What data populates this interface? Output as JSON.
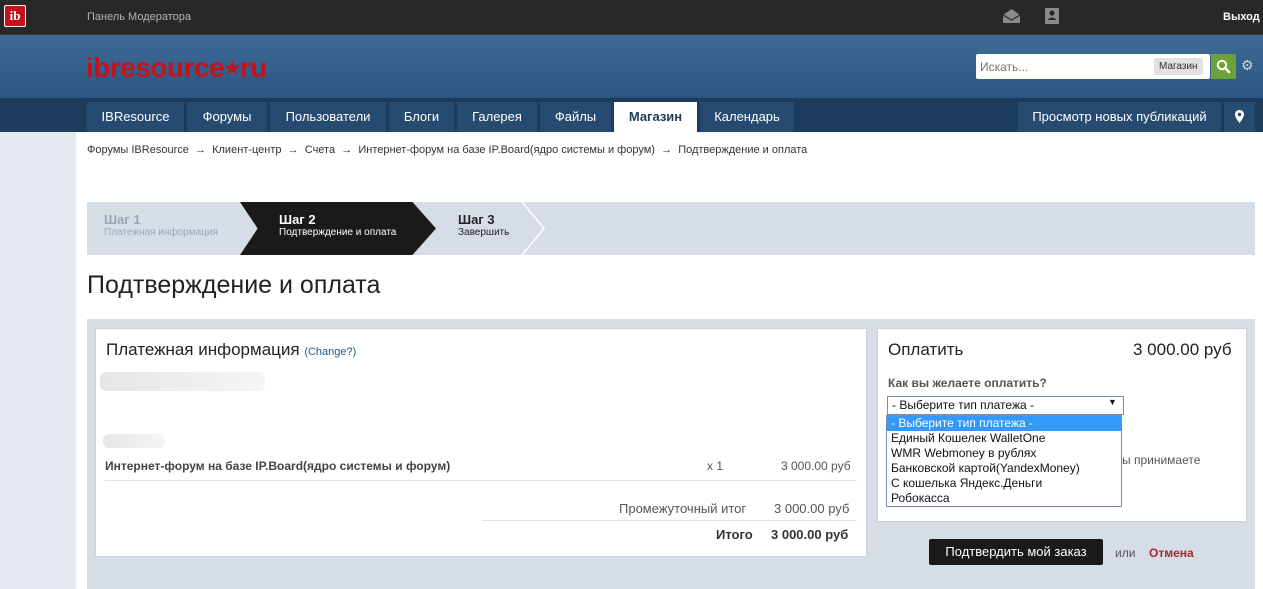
{
  "topbar": {
    "logo_text": "ib",
    "mod_panel": "Панель Модератора",
    "logout": "Выход"
  },
  "header": {
    "brand_ib": "ib",
    "brand_resource": "resource",
    "brand_star": "★",
    "brand_ru": "ru",
    "search_placeholder": "Искать...",
    "search_scope": "Магазин"
  },
  "nav": {
    "tabs": [
      "IBResource",
      "Форумы",
      "Пользователи",
      "Блоги",
      "Галерея",
      "Файлы",
      "Магазин",
      "Календарь"
    ],
    "active": "Магазин",
    "new_posts": "Просмотр новых публикаций"
  },
  "breadcrumb": {
    "items": [
      "Форумы IBResource",
      "Клиент-центр",
      "Счета",
      "Интернет-форум на базе IP.Board(ядро системы и форум)",
      "Подтверждение и оплата"
    ],
    "sep": "→"
  },
  "steps": [
    {
      "title": "Шаг 1",
      "sub": "Платежная информация"
    },
    {
      "title": "Шаг 2",
      "sub": "Подтверждение и оплата"
    },
    {
      "title": "Шаг 3",
      "sub": "Завершить"
    }
  ],
  "page_title": "Подтверждение и оплата",
  "billing": {
    "title": "Платежная информация",
    "change": "(Change?)",
    "item_name": "Интернет-форум на базе IP.Board(ядро системы и форум)",
    "item_qty": "x 1",
    "item_price": "3 000.00 руб",
    "subtotal_label": "Промежуточный итог",
    "subtotal": "3 000.00 руб",
    "total_label": "Итого",
    "total": "3 000.00 руб"
  },
  "payment": {
    "title": "Оплатить",
    "amount": "3 000.00 руб",
    "question": "Как вы желаете оплатить?",
    "selected": "- Выберите тип платежа -",
    "options": [
      "- Выберите тип платежа -",
      "Единый Кошелек WalletOne",
      "WMR Webmoney в рублях",
      "Банковской картой(YandexMoney)",
      "С кошелька Яндекс.Деньги",
      "Робокасса"
    ],
    "accept_fragment": "ы принимаете",
    "confirm": "Подтвердить мой заказ",
    "or": "или",
    "cancel": "Отмена"
  },
  "colors": {
    "brand_red": "#c4121b",
    "header_blue": "#2c5682",
    "nav_dark": "#1d3b5c",
    "search_green": "#6ca339",
    "select_highlight": "#3399ff",
    "cancel_red": "#a52a2a"
  }
}
